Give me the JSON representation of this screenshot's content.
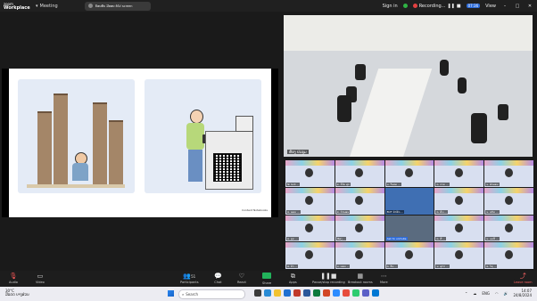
{
  "titlebar": {
    "brand_top": "zoom",
    "brand_bottom": "Workplace",
    "meeting_label": "Meeting",
    "tab_title": "ຍ້ອນກັບ ມີຕອນ ຕໍ່ໄປ screen",
    "sign_in": "Sign in",
    "recording": "Recording...",
    "badge": "07:36",
    "view": "View"
  },
  "share": {
    "caption": "Content Notebooks"
  },
  "video": {
    "speaker_name": "ຫ້ອງ ປະຊຸມ"
  },
  "grid": {
    "tiles": [
      "Ni Iadi ...",
      "ທ. ວິໄລ ສຸກ",
      "ນ. ຈັນທະ ...",
      "ທ. ດາວ ...",
      "ນ. ອຳພອນ",
      "ທ. ພອນ ...",
      "ທ. ຄຳພອນ",
      "BUT ສຳນັກ ...",
      "ທ. ສົມ ...",
      "ນ. ແກ້ວ ...",
      "ທ. ບຸນ ...",
      "ຫ້ອງ ...",
      "Ask to unmute",
      "ທ. ສີ ...",
      "ນ. ມະນີ ...",
      "ທ. ຄຳ ...",
      "ນ. ພອນ ...",
      "ທ. ວັນ ...",
      "ນ. ສຸດາ ...",
      "ທ. ໄຊ ..."
    ]
  },
  "controls": {
    "audio": "Audio",
    "video": "Video",
    "participants": "Participants",
    "participants_count": "51",
    "chat": "Chat",
    "react": "React",
    "share": "Share",
    "apps": "Apps",
    "recording": "Pause/stop recording",
    "view": "Breakout rooms",
    "more": "More",
    "leave": "Leave room"
  },
  "taskbar": {
    "temp": "30°C",
    "weather": "ມີແດດ ບາງສ່ວນ",
    "search_placeholder": "Search",
    "lang": "ENG",
    "time": "14:07",
    "date": "24/8/2024"
  }
}
